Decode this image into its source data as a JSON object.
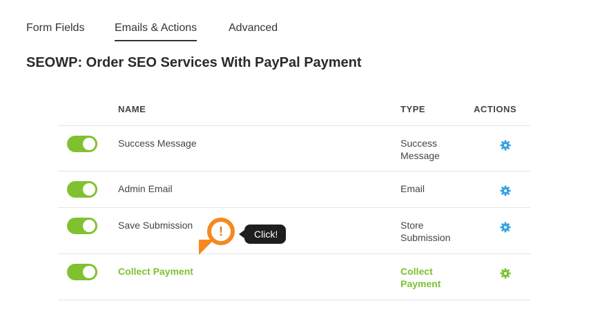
{
  "tabs": [
    {
      "label": "Form Fields",
      "active": false
    },
    {
      "label": "Emails & Actions",
      "active": true
    },
    {
      "label": "Advanced",
      "active": false
    }
  ],
  "form_title": "SEOWP: Order SEO Services With PayPal Payment",
  "table": {
    "headers": {
      "name": "NAME",
      "type": "TYPE",
      "actions": "ACTIONS"
    },
    "rows": [
      {
        "enabled": true,
        "name": "Success Message",
        "type": "Success Message",
        "action_icon": "gear-icon"
      },
      {
        "enabled": true,
        "name": "Admin Email",
        "type": "Email",
        "action_icon": "gear-icon"
      },
      {
        "enabled": true,
        "name": "Save Submission",
        "type": "Store Submission",
        "action_icon": "gear-icon"
      },
      {
        "enabled": true,
        "name": "Collect Payment",
        "type": "Collect Payment",
        "action_icon": "gear-icon",
        "highlighted": true
      }
    ]
  },
  "callout": {
    "icon": "exclamation-icon",
    "symbol": "!",
    "label": "Click!"
  },
  "colors": {
    "toggle_on": "#80c130",
    "gear": "#2ea2e0",
    "gear_highlight": "#7cc232",
    "highlight_text": "#7cc232",
    "callout_orange": "#f5891f",
    "callout_dark": "#1e1e1e"
  }
}
